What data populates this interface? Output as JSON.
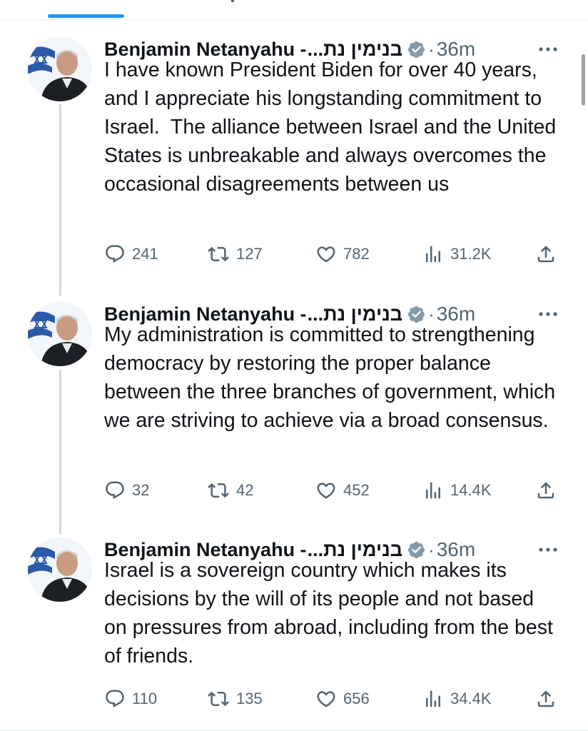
{
  "colors": {
    "accent": "#1d9bf0",
    "text_primary": "#0f1419",
    "text_secondary": "#536471",
    "verified_badge": "#829aab",
    "thread_line": "#cfd9de"
  },
  "icons": {
    "reply": "speech-bubble",
    "retweet": "retweet-arrows",
    "like": "heart",
    "views": "bar-chart",
    "share": "upload-arrow",
    "verified": "verified-badge",
    "more": "ellipsis"
  },
  "tweets": [
    {
      "author": {
        "display_name": "Benjamin Netanyahu -",
        "hebrew_name": "בנימין נת...",
        "verified": true
      },
      "dot": "·",
      "timestamp": "36m",
      "text": "I have known President Biden for over 40 years, and I appreciate his longstanding commitment to Israel.  The alliance between Israel and the United States is unbreakable and always overcomes the occasional disagreements between us",
      "stats": {
        "replies": "241",
        "retweets": "127",
        "likes": "782",
        "views": "31.2K"
      }
    },
    {
      "author": {
        "display_name": "Benjamin Netanyahu -",
        "hebrew_name": "בנימין נת...",
        "verified": true
      },
      "dot": "·",
      "timestamp": "36m",
      "text": "My administration is committed to strengthening democracy by restoring the proper balance between the three branches of government, which we are striving to achieve via a broad consensus.",
      "stats": {
        "replies": "32",
        "retweets": "42",
        "likes": "452",
        "views": "14.4K"
      }
    },
    {
      "author": {
        "display_name": "Benjamin Netanyahu -",
        "hebrew_name": "בנימין נת...",
        "verified": true
      },
      "dot": "·",
      "timestamp": "36m",
      "text": "Israel is a sovereign country which makes its decisions by the will of its people and not based on pressures from abroad, including from the best of friends.",
      "stats": {
        "replies": "110",
        "retweets": "135",
        "likes": "656",
        "views": "34.4K"
      }
    }
  ]
}
